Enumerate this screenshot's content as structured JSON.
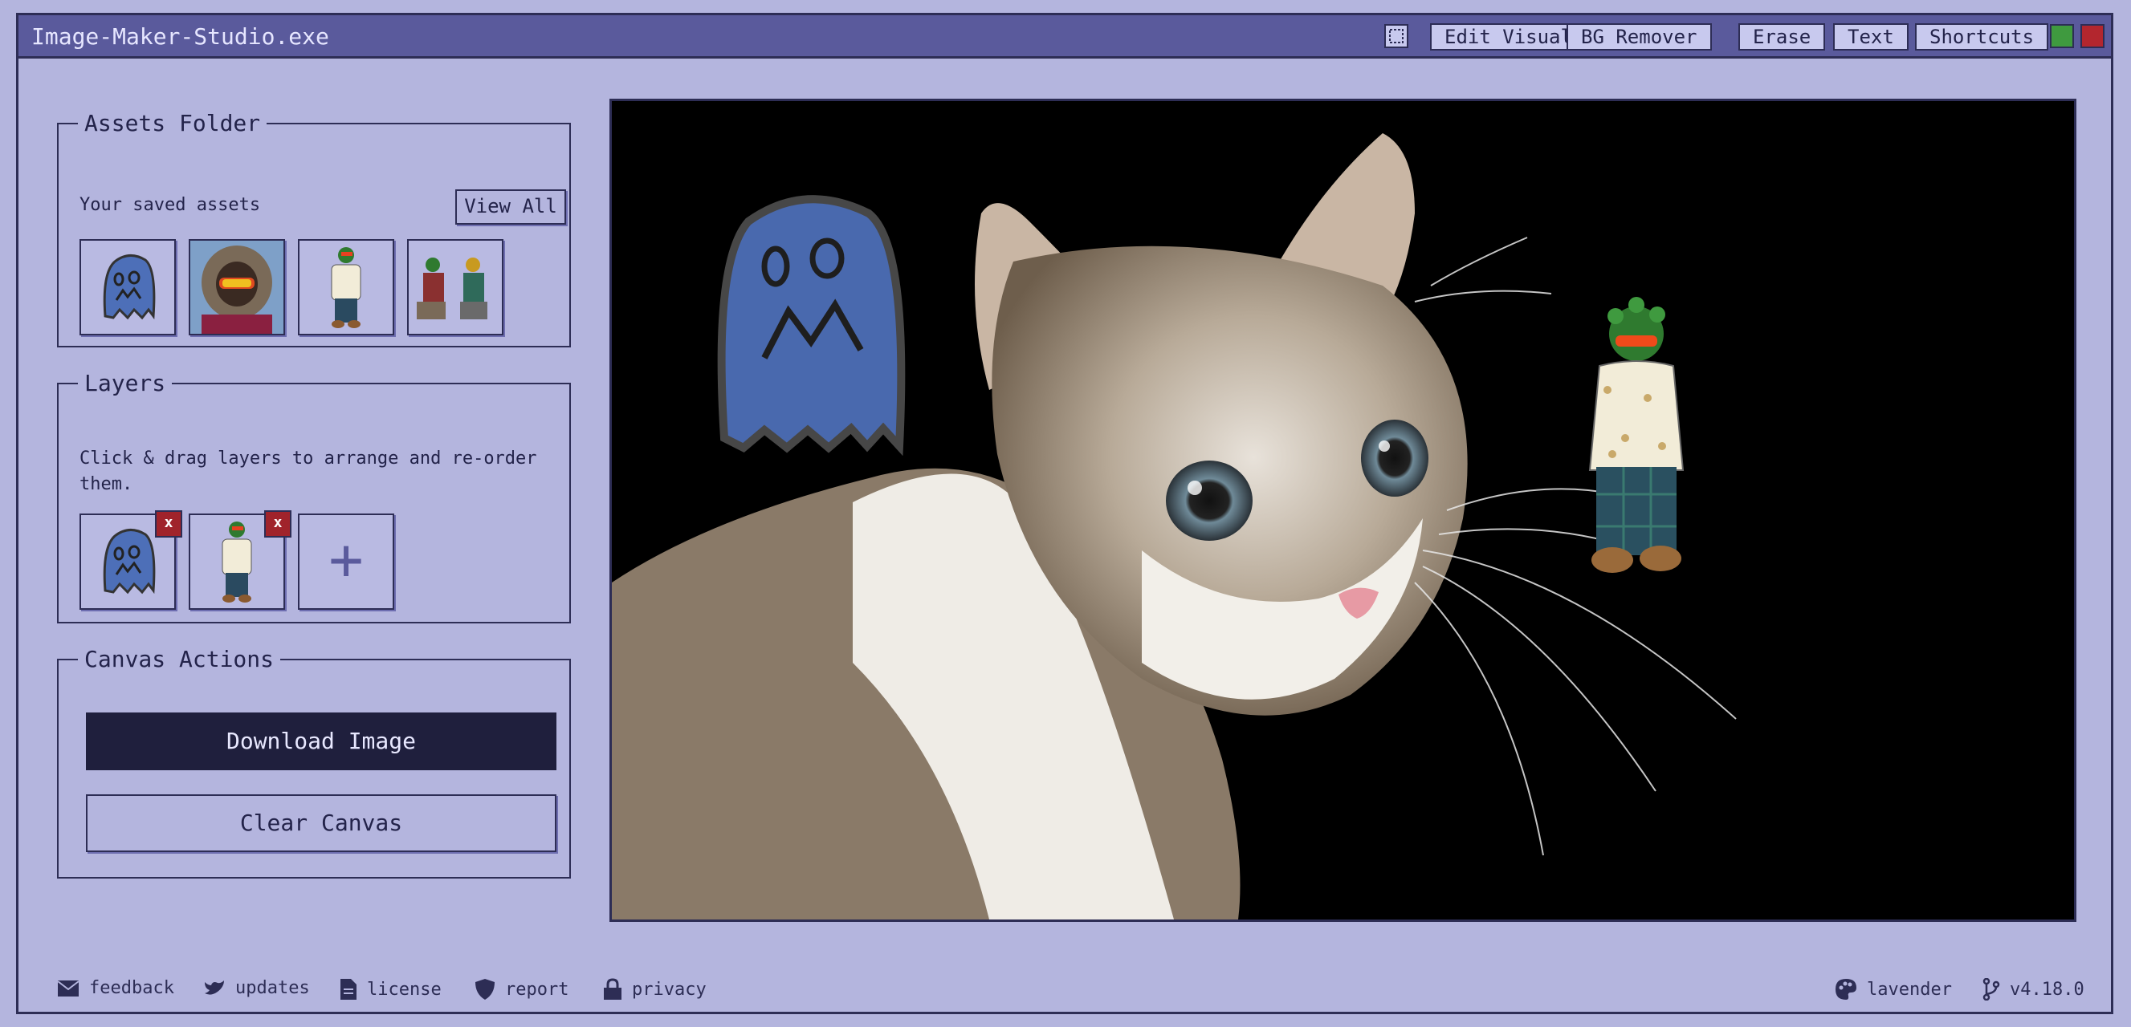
{
  "window": {
    "title": "Image-Maker-Studio.exe"
  },
  "toolbar": {
    "select_icon": "select-marquee-icon",
    "buttons": [
      "Edit Visuals",
      "BG Remover",
      "Erase",
      "Text",
      "Shortcuts"
    ],
    "green_color": "#3f9a3f",
    "red_color": "#b3262e"
  },
  "assets": {
    "legend": "Assets Folder",
    "subtitle": "Your saved assets",
    "view_all": "View All",
    "thumbnails": [
      "blue-ghost",
      "parka-person",
      "green-character",
      "two-characters"
    ]
  },
  "layers": {
    "legend": "Layers",
    "help": "Click & drag layers to arrange and re-order them.",
    "items": [
      "blue-ghost",
      "green-character"
    ],
    "delete_label": "x",
    "add_label": "+"
  },
  "actions": {
    "legend": "Canvas Actions",
    "download": "Download Image",
    "clear": "Clear Canvas"
  },
  "footer": {
    "left": [
      {
        "icon": "mail-icon",
        "label": "feedback"
      },
      {
        "icon": "bird-icon",
        "label": "updates"
      },
      {
        "icon": "document-icon",
        "label": "license"
      },
      {
        "icon": "shield-icon",
        "label": "report"
      },
      {
        "icon": "lock-icon",
        "label": "privacy"
      }
    ],
    "theme": {
      "icon": "palette-icon",
      "label": "lavender"
    },
    "version": {
      "icon": "branch-icon",
      "label": "v4.18.0"
    }
  },
  "colors": {
    "background": "#b4b5de",
    "titlebar": "#5a5a9c",
    "ink": "#2d2d55",
    "dark_button": "#1f1f3d",
    "ghost_blue": "#4d6fb8"
  }
}
